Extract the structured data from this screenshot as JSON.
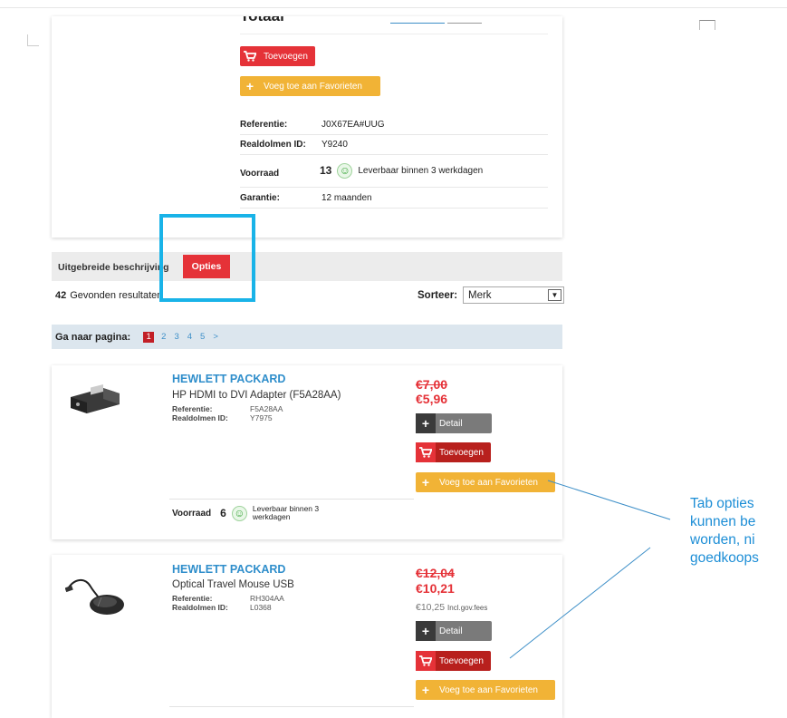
{
  "top_card": {
    "title_cut": "Totaal",
    "price_cut": "",
    "add_label": "Toevoegen",
    "fav_label": "Voeg toe aan Favorieten",
    "specs": [
      {
        "key": "Referentie:",
        "value": "J0X67EA#UUG"
      },
      {
        "key": "Realdolmen ID:",
        "value": "Y9240"
      },
      {
        "key": "Voorraad",
        "stock": "13",
        "value": "Leverbaar binnen 3 werkdagen"
      },
      {
        "key": "Garantie:",
        "value": "12 maanden"
      }
    ]
  },
  "tabs": {
    "uitgebreide": "Uitgebreide beschrijving",
    "opties": "Opties"
  },
  "results": {
    "count": "42",
    "label": "Gevonden resultaten",
    "sort_label": "Sorteer:",
    "sort_value": "Merk"
  },
  "pager": {
    "label": "Ga naar pagina:",
    "pages": [
      "1",
      "2",
      "3",
      "4",
      "5",
      ">"
    ]
  },
  "products": [
    {
      "brand": "HEWLETT PACKARD",
      "name": "HP HDMI to DVI Adapter (F5A28AA)",
      "ref_label": "Referentie:",
      "ref": "F5A28AA",
      "id_label": "Realdolmen ID:",
      "id": "Y7975",
      "price_old": "€7,00",
      "price_new": "€5,96",
      "detail_label": "Detail",
      "add_label": "Toevoegen",
      "fav_label": "Voeg toe aan Favorieten",
      "stock_label": "Voorraad",
      "stock_count": "6",
      "stock_text": "Leverbaar binnen 3 werkdagen"
    },
    {
      "brand": "HEWLETT PACKARD",
      "name": "Optical Travel Mouse USB",
      "ref_label": "Referentie:",
      "ref": "RH304AA",
      "id_label": "Realdolmen ID:",
      "id": "L0368",
      "price_old": "€12,04",
      "price_new": "€10,21",
      "price_gov": "€10,25",
      "price_gov_note": "Incl.gov.fees",
      "detail_label": "Detail",
      "add_label": "Toevoegen",
      "fav_label": "Voeg toe aan Favorieten"
    }
  ],
  "callout": {
    "lines": [
      "Tab opties",
      "kunnen be",
      "worden, ni",
      "goedkoops"
    ]
  },
  "colors": {
    "red": "#e53238",
    "dark_red": "#b8201d",
    "yellow": "#f1b336",
    "blue_link": "#2f8ecb",
    "highlight": "#19b3e8"
  }
}
